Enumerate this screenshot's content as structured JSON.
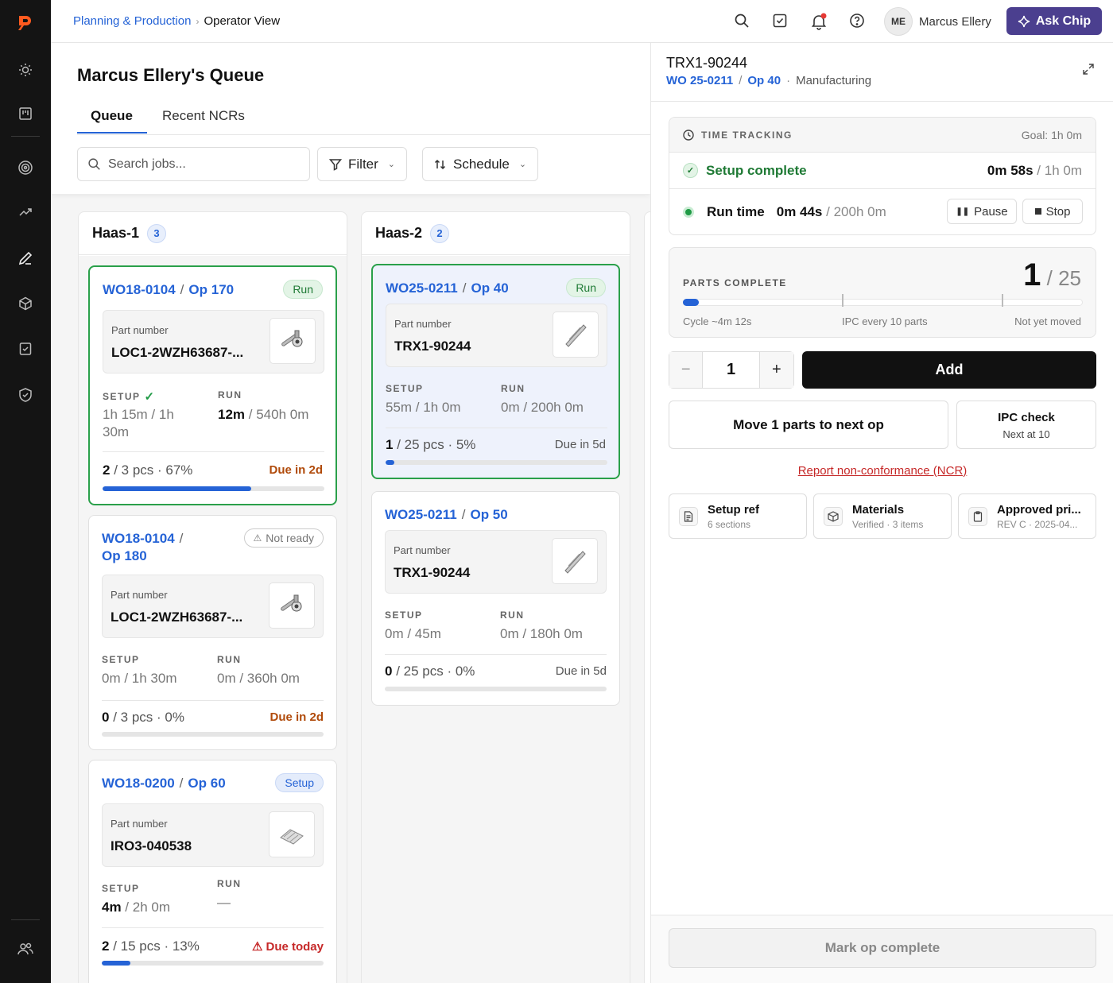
{
  "breadcrumb": {
    "parent": "Planning & Production",
    "current": "Operator View"
  },
  "user": {
    "initials": "ME",
    "name": "Marcus Ellery"
  },
  "ask_chip": "Ask Chip",
  "queue": {
    "title": "Marcus Ellery's Queue",
    "tabs": [
      "Queue",
      "Recent NCRs"
    ],
    "search_placeholder": "Search jobs...",
    "filter_label": "Filter",
    "schedule_label": "Schedule"
  },
  "columns": [
    {
      "name": "Haas-1",
      "count": "3",
      "cards": [
        {
          "wo": "WO18-0104",
          "op": "Op 170",
          "badge": "Run",
          "part_label": "Part number",
          "part": "LOC1-2WZH63687-...",
          "setup_label": "SETUP",
          "setup_a": "1h 15m",
          "setup_b": " / 1h 30m",
          "run_label": "RUN",
          "run_a": "12m",
          "run_b": " / 540h 0m",
          "pcs_a": "2",
          "pcs_b": " / 3 pcs · 67%",
          "due": "Due in 2d",
          "progress": 0.67
        },
        {
          "wo": "WO18-0104",
          "op": "Op 180",
          "badge": "Not ready",
          "part_label": "Part number",
          "part": "LOC1-2WZH63687-...",
          "setup_label": "SETUP",
          "setup_a": "",
          "setup_b": "0m / 1h 30m",
          "run_label": "RUN",
          "run_a": "",
          "run_b": "0m / 360h 0m",
          "pcs_a": "0",
          "pcs_b": " / 3 pcs · 0%",
          "due": "Due in 2d",
          "progress": 0
        },
        {
          "wo": "WO18-0200",
          "op": "Op 60",
          "badge": "Setup",
          "part_label": "Part number",
          "part": "IRO3-040538",
          "setup_label": "SETUP",
          "setup_a": "4m",
          "setup_b": " / 2h 0m",
          "run_label": "RUN",
          "run_a": "",
          "run_b": "—",
          "pcs_a": "2",
          "pcs_b": " / 15 pcs · 13%",
          "due": "Due today",
          "progress": 0.13
        }
      ]
    },
    {
      "name": "Haas-2",
      "count": "2",
      "cards": [
        {
          "wo": "WO25-0211",
          "op": "Op 40",
          "badge": "Run",
          "part_label": "Part number",
          "part": "TRX1-90244",
          "setup_label": "SETUP",
          "setup_a": "",
          "setup_b": "55m / 1h 0m",
          "run_label": "RUN",
          "run_a": "",
          "run_b": "0m / 200h 0m",
          "pcs_a": "1",
          "pcs_b": " / 25 pcs · 5%",
          "due": "Due in 5d",
          "progress": 0.04
        },
        {
          "wo": "WO25-0211",
          "op": "Op 50",
          "badge": "",
          "part_label": "Part number",
          "part": "TRX1-90244",
          "setup_label": "SETUP",
          "setup_a": "",
          "setup_b": "0m / 45m",
          "run_label": "RUN",
          "run_a": "",
          "run_b": "0m / 180h 0m",
          "pcs_a": "0",
          "pcs_b": " / 25 pcs · 0%",
          "due": "Due in 5d",
          "progress": 0
        }
      ]
    }
  ],
  "panel": {
    "title": "TRX1-90244",
    "wo": "WO 25-0211",
    "op": "Op 40",
    "dept": "Manufacturing",
    "time_tracking": {
      "label": "TIME TRACKING",
      "goal": "Goal: 1h 0m",
      "setup_status": "Setup complete",
      "setup_time": "0m 58s",
      "setup_goal": " / 1h 0m",
      "run_label": "Run time",
      "run_time": "0m 44s",
      "run_goal": " / 200h 0m",
      "pause": "Pause",
      "stop": "Stop"
    },
    "parts": {
      "label": "PARTS COMPLETE",
      "done": "1",
      "total": " / 25",
      "progress": 0.04,
      "cycle": "Cycle ~4m 12s",
      "ipc": "IPC every 10 parts",
      "moved": "Not yet moved"
    },
    "qty": "1",
    "add": "Add",
    "move": "Move 1 parts to next op",
    "ipc_title": "IPC check",
    "ipc_sub": "Next at 10",
    "ncr": "Report non-conformance (NCR)",
    "refs": [
      {
        "title": "Setup ref",
        "sub": "6 sections"
      },
      {
        "title": "Materials",
        "sub": "Verified · 3 items"
      },
      {
        "title": "Approved pri...",
        "sub": "REV C · 2025-04..."
      }
    ],
    "mark_complete": "Mark op complete"
  }
}
